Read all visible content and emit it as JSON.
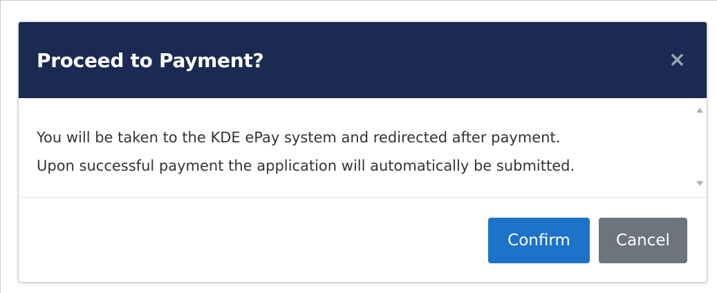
{
  "modal": {
    "title": "Proceed to Payment?",
    "close_symbol": "×",
    "body_lines": [
      "You will be taken to the KDE ePay system and redirected after payment.",
      "Upon successful payment the application will automatically be submitted."
    ],
    "buttons": {
      "confirm_label": "Confirm",
      "cancel_label": "Cancel"
    }
  },
  "icons": {
    "close": "close-icon",
    "scroll_up": "scroll-up-arrow-icon",
    "scroll_down": "scroll-down-arrow-icon"
  },
  "colors": {
    "header_bg": "#1a2a52",
    "confirm_bg": "#1c73c8",
    "cancel_bg": "#6c757d"
  }
}
